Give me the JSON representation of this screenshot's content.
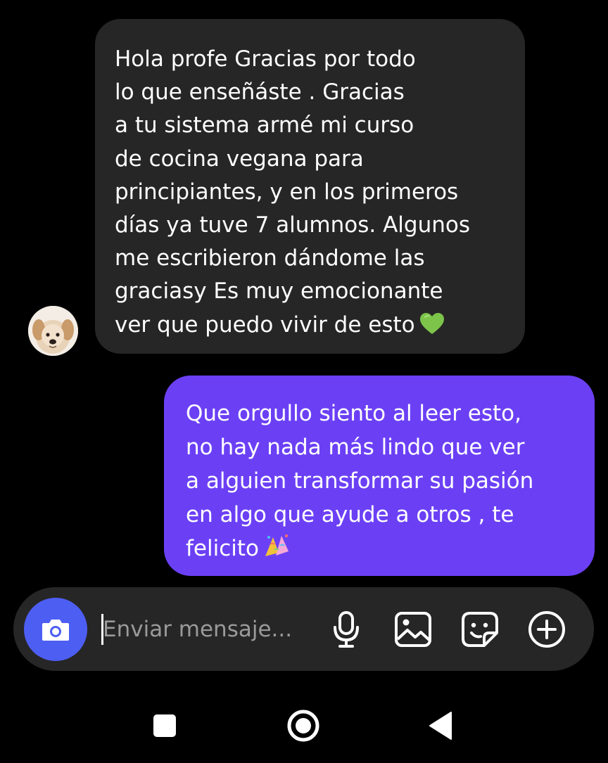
{
  "conversation": {
    "incoming_message": {
      "lines": [
        "Hola profe Gracias por todo",
        "lo que enseñáste . Gracias",
        "a tu sistema armé mi curso",
        "de cocina vegana para",
        "principiantes, y en los primeros",
        "días ya tuve 7 alumnos. Algunos",
        "me escribieron dándome las",
        "graciasy  Es muy emocionante",
        "ver que puedo vivir de esto"
      ],
      "emoji": "green-heart",
      "bubble_color": "#262626"
    },
    "outgoing_message": {
      "lines": [
        "Que orgullo siento al leer esto,",
        "no hay nada más lindo que ver",
        "a alguien transformar su pasión",
        "en algo que ayude a otros , te",
        "felicito"
      ],
      "emoji": "confetti",
      "bubble_color": "#6b40f5"
    }
  },
  "composer": {
    "placeholder": "Enviar mensaje...",
    "value": "",
    "camera_color": "#4d5ef3",
    "icons": [
      "camera-icon",
      "microphone-icon",
      "image-icon",
      "sticker-icon",
      "plus-circle-icon"
    ]
  },
  "system_nav": {
    "icons": [
      "recents-square-icon",
      "home-circle-icon",
      "back-triangle-icon"
    ]
  }
}
